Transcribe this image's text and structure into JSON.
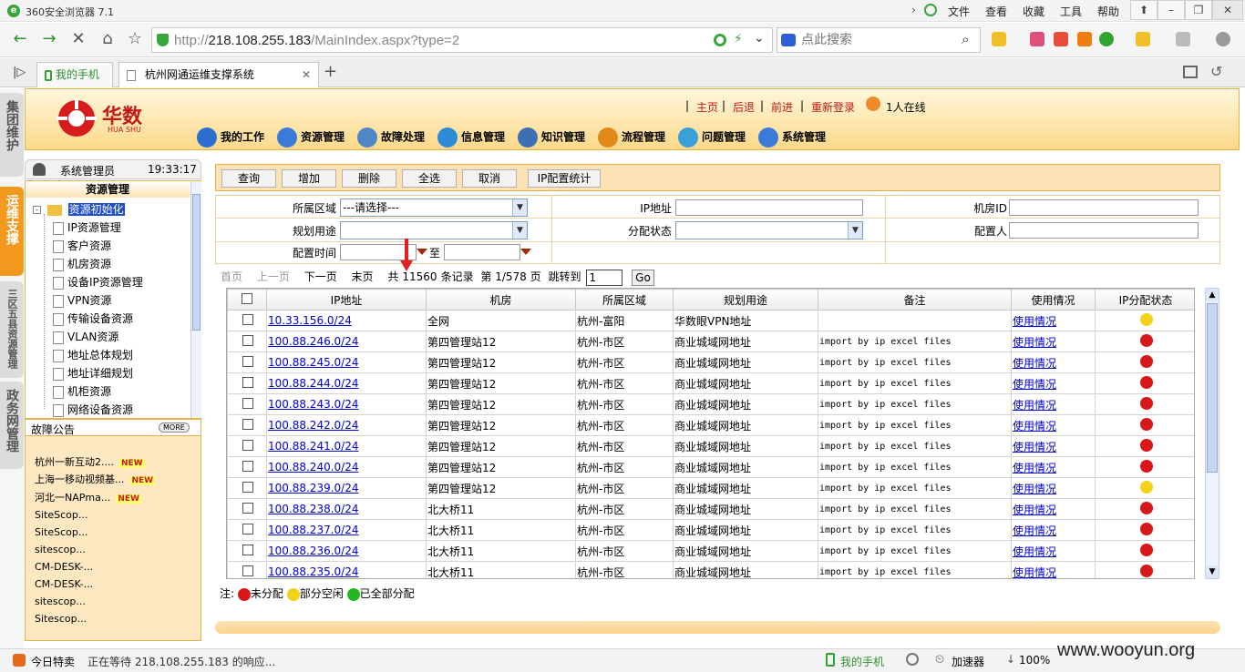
{
  "browser": {
    "title": "360安全浏览器 7.1",
    "menus": [
      "文件",
      "查看",
      "收藏",
      "工具",
      "帮助"
    ],
    "url_prefix": "http://",
    "url_host": "218.108.255.183",
    "url_path": "/MainIndex.aspx?type=2",
    "search_placeholder": "点此搜索",
    "tabs": [
      {
        "label": "我的手机"
      },
      {
        "label": "杭州网通运维支撑系统"
      }
    ]
  },
  "side_tabs": [
    "集团维护",
    "运维支撑",
    "三区五县资源管理",
    "政务网管理"
  ],
  "header": {
    "brand": "华数",
    "brand_sub": "HUA SHU",
    "links": [
      "主页",
      "后退",
      "前进",
      "重新登录"
    ],
    "online": "1人在线",
    "nav": [
      "我的工作",
      "资源管理",
      "故障处理",
      "信息管理",
      "知识管理",
      "流程管理",
      "问题管理",
      "系统管理"
    ],
    "nav_colors": [
      "#2c6fd0",
      "#3a7ad8",
      "#4f86c6",
      "#2e8bd8",
      "#3c6fb4",
      "#e08a1a",
      "#3aa0d8",
      "#3a7ad8"
    ]
  },
  "user": {
    "name": "系统管理员",
    "time": "19:33:17"
  },
  "tree": {
    "title": "资源管理",
    "root": "资源初始化",
    "items": [
      "IP资源管理",
      "客户资源",
      "机房资源",
      "设备IP资源管理",
      "VPN资源",
      "传输设备资源",
      "VLAN资源",
      "地址总体规划",
      "地址详细规划",
      "机柜资源",
      "网络设备资源"
    ]
  },
  "notices": {
    "title": "故障公告",
    "more": "MORE",
    "new_label": "NEW",
    "items": [
      "杭州一新互动2....",
      "上海一移动视频基...",
      "河北一NAPma...",
      "SiteScop...",
      "SiteScop...",
      "sitescop...",
      "CM-DESK-...",
      "CM-DESK-...",
      "sitescop...",
      "Sitescop..."
    ]
  },
  "actions": [
    "查询",
    "增加",
    "删除",
    "全选",
    "取消",
    "IP配置统计"
  ],
  "filters": {
    "region_label": "所属区域",
    "region_value": "---请选择---",
    "ip_label": "IP地址",
    "room_label": "机房ID",
    "purpose_label": "规划用途",
    "status_label": "分配状态",
    "configurer_label": "配置人",
    "time_label": "配置时间",
    "to_label": "至"
  },
  "pager": {
    "first": "首页",
    "prev": "上一页",
    "next": "下一页",
    "last": "末页",
    "total_prefix": "共",
    "total": "11560",
    "total_suffix": "条记录",
    "page_info": "第 1/578 页",
    "jump_label": "跳转到",
    "jump_value": "1",
    "go": "Go"
  },
  "grid": {
    "headers": [
      "",
      "IP地址",
      "机房",
      "所属区域",
      "规划用途",
      "备注",
      "使用情况",
      "IP分配状态"
    ],
    "rows": [
      {
        "ip": "10.33.156.0/24",
        "room": "全网",
        "region": "杭州-富阳",
        "purpose": "华数眼VPN地址",
        "remark": "",
        "usage": "使用情况",
        "status": "yellow"
      },
      {
        "ip": "100.88.246.0/24",
        "room": "第四管理站12",
        "region": "杭州-市区",
        "purpose": "商业城域网地址",
        "remark": "import by ip excel files",
        "usage": "使用情况",
        "status": "red"
      },
      {
        "ip": "100.88.245.0/24",
        "room": "第四管理站12",
        "region": "杭州-市区",
        "purpose": "商业城域网地址",
        "remark": "import by ip excel files",
        "usage": "使用情况",
        "status": "red"
      },
      {
        "ip": "100.88.244.0/24",
        "room": "第四管理站12",
        "region": "杭州-市区",
        "purpose": "商业城域网地址",
        "remark": "import by ip excel files",
        "usage": "使用情况",
        "status": "red"
      },
      {
        "ip": "100.88.243.0/24",
        "room": "第四管理站12",
        "region": "杭州-市区",
        "purpose": "商业城域网地址",
        "remark": "import by ip excel files",
        "usage": "使用情况",
        "status": "red"
      },
      {
        "ip": "100.88.242.0/24",
        "room": "第四管理站12",
        "region": "杭州-市区",
        "purpose": "商业城域网地址",
        "remark": "import by ip excel files",
        "usage": "使用情况",
        "status": "red"
      },
      {
        "ip": "100.88.241.0/24",
        "room": "第四管理站12",
        "region": "杭州-市区",
        "purpose": "商业城域网地址",
        "remark": "import by ip excel files",
        "usage": "使用情况",
        "status": "red"
      },
      {
        "ip": "100.88.240.0/24",
        "room": "第四管理站12",
        "region": "杭州-市区",
        "purpose": "商业城域网地址",
        "remark": "import by ip excel files",
        "usage": "使用情况",
        "status": "red"
      },
      {
        "ip": "100.88.239.0/24",
        "room": "第四管理站12",
        "region": "杭州-市区",
        "purpose": "商业城域网地址",
        "remark": "import by ip excel files",
        "usage": "使用情况",
        "status": "yellow"
      },
      {
        "ip": "100.88.238.0/24",
        "room": "北大桥11",
        "region": "杭州-市区",
        "purpose": "商业城域网地址",
        "remark": "import by ip excel files",
        "usage": "使用情况",
        "status": "red"
      },
      {
        "ip": "100.88.237.0/24",
        "room": "北大桥11",
        "region": "杭州-市区",
        "purpose": "商业城域网地址",
        "remark": "import by ip excel files",
        "usage": "使用情况",
        "status": "red"
      },
      {
        "ip": "100.88.236.0/24",
        "room": "北大桥11",
        "region": "杭州-市区",
        "purpose": "商业城域网地址",
        "remark": "import by ip excel files",
        "usage": "使用情况",
        "status": "red"
      },
      {
        "ip": "100.88.235.0/24",
        "room": "北大桥11",
        "region": "杭州-市区",
        "purpose": "商业城域网地址",
        "remark": "import by ip excel files",
        "usage": "使用情况",
        "status": "red"
      }
    ]
  },
  "legend": {
    "prefix": "注:",
    "red": "未分配",
    "yellow": "部分空闲",
    "green": "已全部分配"
  },
  "status_colors": {
    "red": "#d81818",
    "yellow": "#f2d21a",
    "green": "#22b822"
  },
  "statusbar": {
    "today": "今日特卖",
    "loading": "正在等待 218.108.255.183 的响应...",
    "phone": "我的手机",
    "accel": "加速器",
    "zoom": "100%",
    "watermark": "www.wooyun.org"
  }
}
